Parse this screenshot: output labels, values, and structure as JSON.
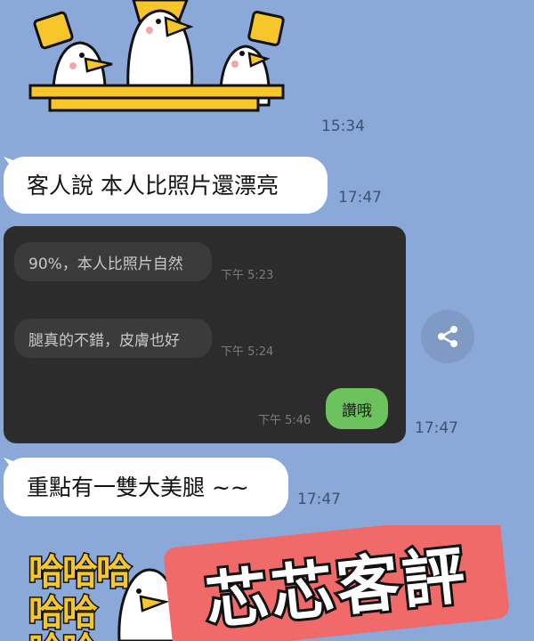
{
  "messages": {
    "sticker_time": "15:34",
    "msg1": {
      "text": "客人說 本人比照片還漂亮",
      "time": "17:47"
    },
    "image_time": "17:47",
    "msg2": {
      "text": "重點有一雙大美腿 ~~",
      "time": "17:47"
    }
  },
  "embedded_screenshot": {
    "bubble1": {
      "text": "90%，本人比照片自然",
      "time": "下午 5:23"
    },
    "bubble2": {
      "text": "腿真的不錯，皮膚也好",
      "time": "下午 5:24"
    },
    "reply": {
      "text": "讚哦",
      "time": "下午 5:46"
    }
  },
  "share_button": {
    "icon": "share-icon"
  },
  "bottom_sticker": {
    "haha_rows": [
      "哈哈哈",
      "哈哈",
      "哈哈"
    ],
    "banner": "芯芯客評"
  },
  "colors": {
    "chat_background": "#8aa8d8",
    "bubble_white": "#ffffff",
    "bubble_green": "#6cc35d",
    "banner_red": "#f06a6a",
    "sticker_yellow": "#f6c62a"
  }
}
